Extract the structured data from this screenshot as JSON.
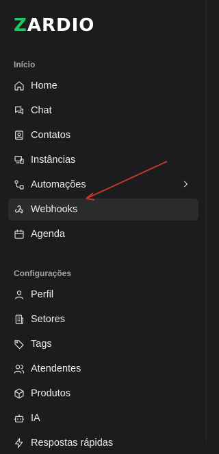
{
  "brand": {
    "logo_first": "Z",
    "logo_rest": "ARDIO",
    "accent": "#22c55e"
  },
  "sections": {
    "inicio": "Início",
    "config": "Configurações"
  },
  "nav": {
    "home": "Home",
    "chat": "Chat",
    "contatos": "Contatos",
    "instancias": "Instâncias",
    "automacoes": "Automações",
    "webhooks": "Webhooks",
    "agenda": "Agenda",
    "perfil": "Perfil",
    "setores": "Setores",
    "tags": "Tags",
    "atendentes": "Atendentes",
    "produtos": "Produtos",
    "ia": "IA",
    "respostas": "Respostas rápidas"
  },
  "active_item": "webhooks",
  "annotation_arrow_color": "#c0392b"
}
